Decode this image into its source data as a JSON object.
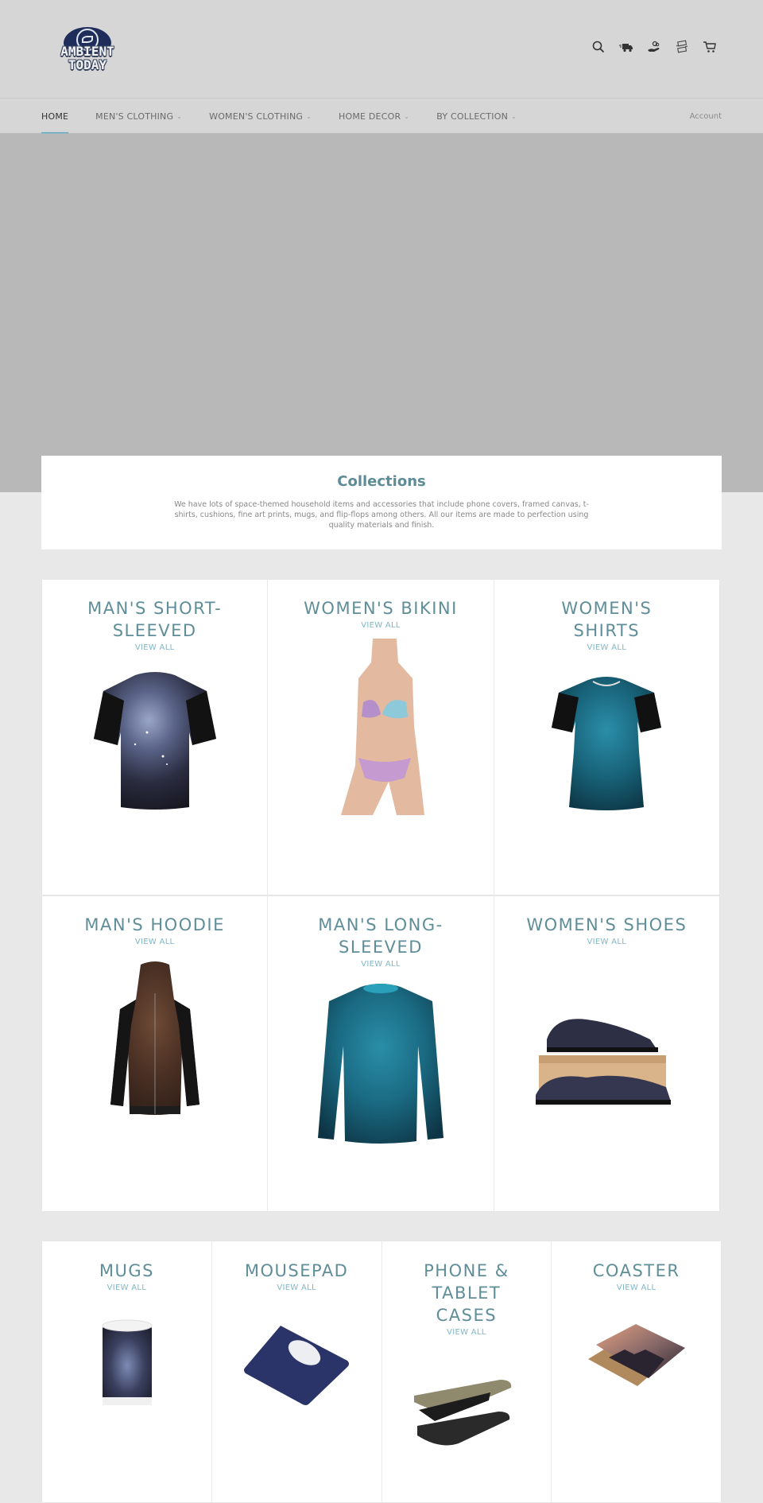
{
  "header": {
    "logo_text_line1": "AMBIENT",
    "logo_text_line2": "TODAY",
    "icons": [
      "search-icon",
      "delivery-truck-icon",
      "hand-money-icon",
      "money-exchange-icon",
      "cart-icon"
    ]
  },
  "nav": {
    "items": [
      {
        "label": "HOME",
        "active": true,
        "dropdown": false
      },
      {
        "label": "MEN'S CLOTHING",
        "active": false,
        "dropdown": true
      },
      {
        "label": "WOMEN'S CLOTHING",
        "active": false,
        "dropdown": true
      },
      {
        "label": "HOME DECOR",
        "active": false,
        "dropdown": true
      },
      {
        "label": "BY COLLECTION",
        "active": false,
        "dropdown": true
      }
    ],
    "chevron": "⌄",
    "account_label": "Account"
  },
  "intro": {
    "title": "Collections",
    "description": "We have lots of space-themed household items and accessories that include phone covers, framed canvas, t-shirts, cushions, fine art prints, mugs, and flip-flops among others. All our items are made to perfection using quality materials and finish."
  },
  "collections": [
    {
      "title": "MAN'S SHORT-SLEEVED",
      "link": "VIEW ALL"
    },
    {
      "title": "WOMEN'S BIKINI",
      "link": "VIEW ALL"
    },
    {
      "title": "WOMEN'S SHIRTS",
      "link": "VIEW ALL"
    },
    {
      "title": "MAN'S HOODIE",
      "link": "VIEW ALL"
    },
    {
      "title": "MAN'S LONG-SLEEVED",
      "link": "VIEW ALL"
    },
    {
      "title": "WOMEN'S SHOES",
      "link": "VIEW ALL"
    },
    {
      "title": "MUGS",
      "link": "VIEW ALL"
    },
    {
      "title": "MOUSEPAD",
      "link": "VIEW ALL"
    },
    {
      "title": "PHONE & TABLET CASES",
      "link": "VIEW ALL"
    },
    {
      "title": "COASTER",
      "link": "VIEW ALL"
    }
  ],
  "colors": {
    "accent": "#79b4c6",
    "title_color": "#5f8e99",
    "header_bg": "#d6d6d6",
    "hero_bg": "#b8b8b8"
  }
}
